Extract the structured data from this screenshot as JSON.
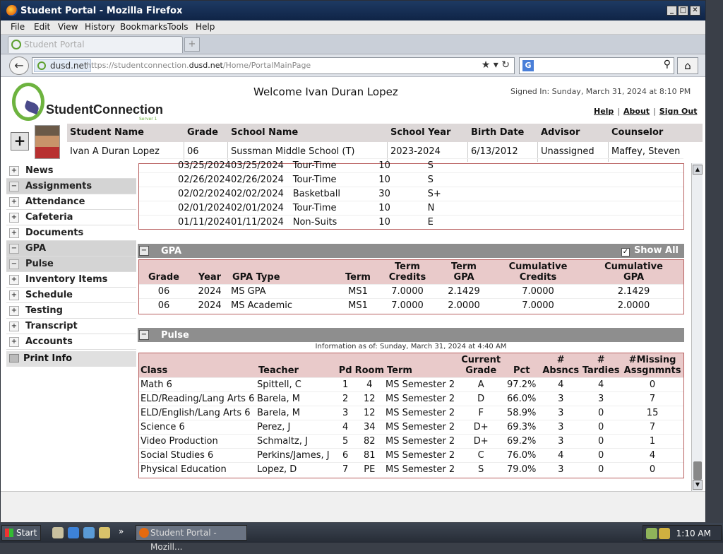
{
  "window": {
    "title": "Student Portal - Mozilla Firefox"
  },
  "menubar": {
    "items": [
      "File",
      "Edit",
      "View",
      "History",
      "Bookmarks",
      "Tools",
      "Help"
    ]
  },
  "browser_tab": {
    "title": "Student Portal"
  },
  "address": {
    "site": "dusd.net",
    "url_prefix": "https://studentconnection.",
    "url_domain": "dusd.net",
    "url_path": "/Home/PortalMainPage"
  },
  "header": {
    "logo_text": "StudentConnection",
    "logo_sub": "Server 1",
    "welcome": "Welcome Ivan Duran Lopez",
    "signed_in": "Signed In: Sunday, March 31, 2024 at 8:10 PM",
    "links": [
      "Help",
      "About",
      "Sign Out"
    ]
  },
  "student": {
    "columns": [
      "Student Name",
      "Grade",
      "School Name",
      "School Year",
      "Birth Date",
      "Advisor",
      "Counselor"
    ],
    "values": [
      "Ivan A Duran Lopez",
      "06",
      "Sussman Middle School (T)",
      "2023-2024",
      "6/13/2012",
      "Unassigned",
      "Maffey, Steven"
    ]
  },
  "sidebar": {
    "items": [
      {
        "label": "News",
        "sign": "+"
      },
      {
        "label": "Assignments",
        "sign": "−"
      },
      {
        "label": "Attendance",
        "sign": "+"
      },
      {
        "label": "Cafeteria",
        "sign": "+"
      },
      {
        "label": "Documents",
        "sign": "+"
      },
      {
        "label": "GPA",
        "sign": "−"
      },
      {
        "label": "Pulse",
        "sign": "−"
      },
      {
        "label": "Inventory Items",
        "sign": "+"
      },
      {
        "label": "Schedule",
        "sign": "+"
      },
      {
        "label": "Testing",
        "sign": "+"
      },
      {
        "label": "Transcript",
        "sign": "+"
      },
      {
        "label": "Accounts",
        "sign": "+"
      }
    ],
    "print_label": "Print Info"
  },
  "assignments": {
    "rows": [
      [
        "03/25/2024",
        "03/25/2024",
        "Tour-Time",
        "10",
        "S"
      ],
      [
        "02/26/2024",
        "02/26/2024",
        "Tour-Time",
        "10",
        "S"
      ],
      [
        "02/02/2024",
        "02/02/2024",
        "Basketball",
        "30",
        "S+"
      ],
      [
        "02/01/2024",
        "02/01/2024",
        "Tour-Time",
        "10",
        "N"
      ],
      [
        "01/11/2024",
        "01/11/2024",
        "Non-Suits",
        "10",
        "E"
      ]
    ]
  },
  "gpa": {
    "title": "GPA",
    "show_all": "Show All",
    "headers": {
      "grade": "Grade",
      "year": "Year",
      "type": "GPA Type",
      "term": "Term",
      "term_credits_1": "Term",
      "term_credits_2": "Credits",
      "term_gpa_1": "Term",
      "term_gpa_2": "GPA",
      "cum_credits_1": "Cumulative",
      "cum_credits_2": "Credits",
      "cum_gpa_1": "Cumulative",
      "cum_gpa_2": "GPA"
    },
    "rows": [
      [
        "06",
        "2024",
        "MS GPA",
        "MS1",
        "7.0000",
        "2.1429",
        "7.0000",
        "2.1429"
      ],
      [
        "06",
        "2024",
        "MS Academic",
        "MS1",
        "7.0000",
        "2.0000",
        "7.0000",
        "2.0000"
      ]
    ]
  },
  "pulse": {
    "title": "Pulse",
    "info": "Information as of: Sunday, March 31, 2024 at 4:40 AM",
    "headers": {
      "class": "Class",
      "teacher": "Teacher",
      "pd": "Pd",
      "room": "Room",
      "term": "Term",
      "grade_1": "Current",
      "grade_2": "Grade",
      "pct": "Pct",
      "abs_1": "#",
      "abs_2": "Absncs",
      "tar_1": "#",
      "tar_2": "Tardies",
      "miss_1": "#Missing",
      "miss_2": "Assgnmnts"
    },
    "rows": [
      [
        "Math 6",
        "Spittell, C",
        "1",
        "4",
        "MS Semester 2",
        "A",
        "97.2%",
        "4",
        "4",
        "0"
      ],
      [
        "ELD/Reading/Lang Arts 6",
        "Barela, M",
        "2",
        "12",
        "MS Semester 2",
        "D",
        "66.0%",
        "3",
        "3",
        "7"
      ],
      [
        "ELD/English/Lang Arts 6",
        "Barela, M",
        "3",
        "12",
        "MS Semester 2",
        "F",
        "58.9%",
        "3",
        "0",
        "15"
      ],
      [
        "Science 6",
        "Perez, J",
        "4",
        "34",
        "MS Semester 2",
        "D+",
        "69.3%",
        "3",
        "0",
        "7"
      ],
      [
        "Video Production",
        "Schmaltz, J",
        "5",
        "82",
        "MS Semester 2",
        "D+",
        "69.2%",
        "3",
        "0",
        "1"
      ],
      [
        "Social Studies 6",
        "Perkins/James, J",
        "6",
        "81",
        "MS Semester 2",
        "C",
        "76.0%",
        "4",
        "0",
        "4"
      ],
      [
        "Physical Education",
        "Lopez, D",
        "7",
        "PE",
        "MS Semester 2",
        "S",
        "79.0%",
        "3",
        "0",
        "0"
      ]
    ]
  },
  "taskbar": {
    "start": "Start",
    "app": "Student Portal - Mozill...",
    "clock": "1:10 AM"
  }
}
